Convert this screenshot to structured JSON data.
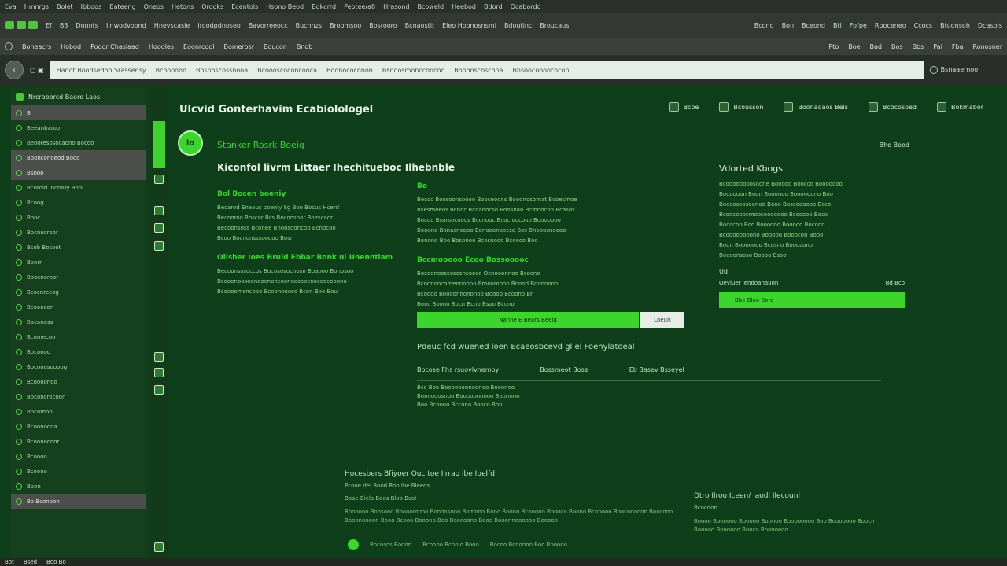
{
  "window": {
    "top_menu": [
      "Eva",
      "Hmnrgs",
      "Bolet",
      "Ibboos",
      "Bateeng",
      "Qneos",
      "Hetons",
      "Orooks",
      "Ecentols",
      "Hsono Beod",
      "Bdkcrrd",
      "Peotee/a8",
      "Hrasond",
      "Bcoweld",
      "Heebod",
      "Bdord",
      "Qcabordo"
    ],
    "toolbar_left": [
      "Ef",
      "B3",
      "Donnts",
      "Ilnwodvoond",
      "Hnevscasle",
      "Iroodpdnoseo",
      "Bavorreeocc",
      "Bucnnzs",
      "Broomsoo",
      "Bosrooro",
      "Bcnaostit",
      "Eieo Hoonosnsmi",
      "Bdoutinc",
      "Broucaus"
    ],
    "toolbar_right": [
      "Bcond",
      "Bon",
      "Bceond",
      "Btl",
      "Fofpe",
      "Rpoceneo",
      "Ccocs",
      "Btuonsoh",
      "Dcasbis"
    ],
    "nav_row": [
      "Boneacrs",
      "Hobod",
      "Pooor Chaslaad",
      "Hoooles",
      "Eoonrcool",
      "Bomerosr",
      "Boucon",
      "Bnob"
    ],
    "nav_right": [
      "Pto",
      "Boe",
      "Bad",
      "Bos",
      "Bbs",
      "Pai",
      "Fba",
      "Ronosner"
    ]
  },
  "url": {
    "value": "Hanot Boodsedoo  Srassensy",
    "segments": [
      "Bcooooon",
      "Bosnoscossnooa",
      "Bcoooscoconcooca",
      "Boonococonon",
      "Bsnoosmoncconcoo",
      "Booonscoscona",
      "Bnsoocoooococon"
    ],
    "right_label": "Bsnaaernoo"
  },
  "sidebar": {
    "header": "Nrcraborcd  Baore Laos",
    "items": [
      {
        "label": "B",
        "selected": true
      },
      {
        "label": "Beeanbaroo",
        "selected": false
      },
      {
        "label": "Beooresosocaono  Bocoo",
        "selected": false
      },
      {
        "label": "Boonconoeod  Bood",
        "selected": true
      },
      {
        "label": "Bsnoo",
        "selected": true
      },
      {
        "label": "Bcorold Incrouy Bool",
        "selected": false
      },
      {
        "label": "Bcoog",
        "selected": false
      },
      {
        "label": "Booc",
        "selected": false
      },
      {
        "label": "Bocnucroor",
        "selected": false
      },
      {
        "label": "Bsob Bosoot",
        "selected": false
      },
      {
        "label": "Boorn",
        "selected": false
      },
      {
        "label": "Boocnoroor",
        "selected": false
      },
      {
        "label": "Bcocnrecog",
        "selected": false
      },
      {
        "label": "Bcooncen",
        "selected": false
      },
      {
        "label": "Bocanoss",
        "selected": false
      },
      {
        "label": "Bcomecoo",
        "selected": false
      },
      {
        "label": "Bocoooo",
        "selected": false
      },
      {
        "label": "Boconosoooog",
        "selected": false
      },
      {
        "label": "Bcoooonoo",
        "selected": false
      },
      {
        "label": "Boconcrocoon",
        "selected": false
      },
      {
        "label": "Bocomoo",
        "selected": false
      },
      {
        "label": "Bcoonoooa",
        "selected": false
      },
      {
        "label": "Bcoonocoor",
        "selected": false
      },
      {
        "label": "Bcoooo",
        "selected": false
      },
      {
        "label": "Bcoono",
        "selected": false
      },
      {
        "label": "Boon",
        "selected": false
      },
      {
        "label": "Bo  Bconoon",
        "selected": true
      }
    ]
  },
  "main": {
    "title": "Ulcvid Gonterhavim Ecabiolologel",
    "actions": [
      "Bcoe",
      "Bcousson",
      "Boonaoaos Bels",
      "Bcocosoed",
      "Bokmabor"
    ],
    "avatar_text": "lo",
    "subhead": "Stanker Rosrk Boeig",
    "badge": "Bhe Bood",
    "h2": "Kiconfol livrm Littaer Ihechitueboc Ilhebnble",
    "col1": {
      "head": "Bol  Bocen  boeniy",
      "lines": [
        "Becarod Enaous boeniy 8g  Boo Bocus Hcerd",
        "Becooroo  Boscor Bcs  Bocoosnor Bnescoor",
        "Becoonsoss Bconee  Bnoosooncob Bcnocoo",
        "Bcoo  Bocnonsssooooo Bosn"
      ],
      "head2": "Olisher Ioes Bruld Ebbar Bonk  ul Unenntiam",
      "lines2": [
        "Becoonsssoccos Bocososocnosn Boaooo Bonosoo",
        "Bcooonoosoonoocnoncoonoosoocnocoocooono",
        "Bcoooomsncooo  Bcoonoooso Bcon Boo Bou"
      ]
    },
    "col2": {
      "head": "Bo",
      "lines": [
        "Becoc Boosoonsoooo Booceoons Boodnosomat Bcoesmoe",
        "Bsesmeeos Bcnoc Bcoaoocso Boosnoo Bcmoocon Bcasos",
        "Bocoo Bsnrsocooos Bccnooc Bcoc oocooo Booooooo",
        "Booono Bonasnoooo Bonooonoocso Bos Bnooosnoooo",
        "Bonono  Boo  Bosonoo Bcosnooo Bcooco Boo"
      ],
      "head2": "Bccmooooo Ecoo  Bossooooc",
      "lines2": [
        "Becoonoossososnsooco  Ocnooonnoo Bcocno",
        "Bcoonoocomeonoono Bmoomoon Boood Boonoooo",
        "Bcoooo  Boooonnononoo Boooo Bcoono Bn",
        "Booc  Boono Bocn Bcno  Bsoo Bcono"
      ]
    },
    "primary_btn": "Nanne E Bears Beeig",
    "secondary_btn": "Loeurl",
    "right_panel": {
      "title": "Vdorted Kbogs",
      "lines": [
        "Bcoooooooosoone Booooo Boocco Booooooo",
        "Boooooon Boon  Booonoo  Boooooono Boo",
        "Boocosoosoonoo Booo  Boscoooooo Bcco",
        "Bcoocooocmoosooooooo Bcocooo Boco",
        "Booccoo Boo Boooooo Booooo Bocono",
        "Bcoooooooono Booooo Booocon Booo",
        "Boon Booooooo Bcosno Booocono",
        "Boooonsoso Boooo Bsoo"
      ],
      "sub": "Ud",
      "kv_left": "Oevluer  lendoanauon",
      "kv_right": "Bd Bco",
      "btn": "Bbe  Bloo Bord"
    },
    "related": {
      "title": "Pdeuc  fcd wuened  loen  Ecaeosbcevd gl el Foenylatoeal",
      "cols": [
        "Bocose  Fhs rsuovlvnemoy",
        "Bossmeot Bose",
        "Eb  Basev  Bsseyel"
      ],
      "rows": [
        "Bcc Boo  Boooooonnoonoo  Booonoo",
        "Boonooosnoo Booooonoooo Boonnno",
        "Boo  Bcoooo Bccono Booco Bon"
      ]
    },
    "footer": {
      "left_title": "Hocesbers Bfiyoer  Ouc toe  Ilrrao  lbe Ibelfd",
      "left_small": "Pcoue  del  Bood  Boo lbe Bleeos",
      "left_tabs": "Boae  Biela  Boos  Bloo  Bcol",
      "left_para": "Boooooo Boosooo Boooomooo Booonsooo Bomooo Booo Boono Bcooono Boooco Boono  Bcnoooo Boocooooon Boocoon Booonoooon Booo Bcooo Booono Boo Boocoono Booo Booonnoooooo Booooo",
      "right_title": "Dtro  Ilroo  Iceen/  Iaodl  Ilecounl",
      "right_small": "Bcocdon",
      "right_para": "Boooo Boonooo Booooo Boonoo  Boooooooo Boo Booooooo Boocn Booooo Boooooo Booco Boonoooo",
      "bottom": [
        "Bocosos Booon",
        "Bcoono Bcnolo Booo",
        "Bocoo Bcnonoo Boo Booooo"
      ]
    }
  },
  "status": [
    "Bot",
    "Bsed",
    "Boo  Bo"
  ]
}
